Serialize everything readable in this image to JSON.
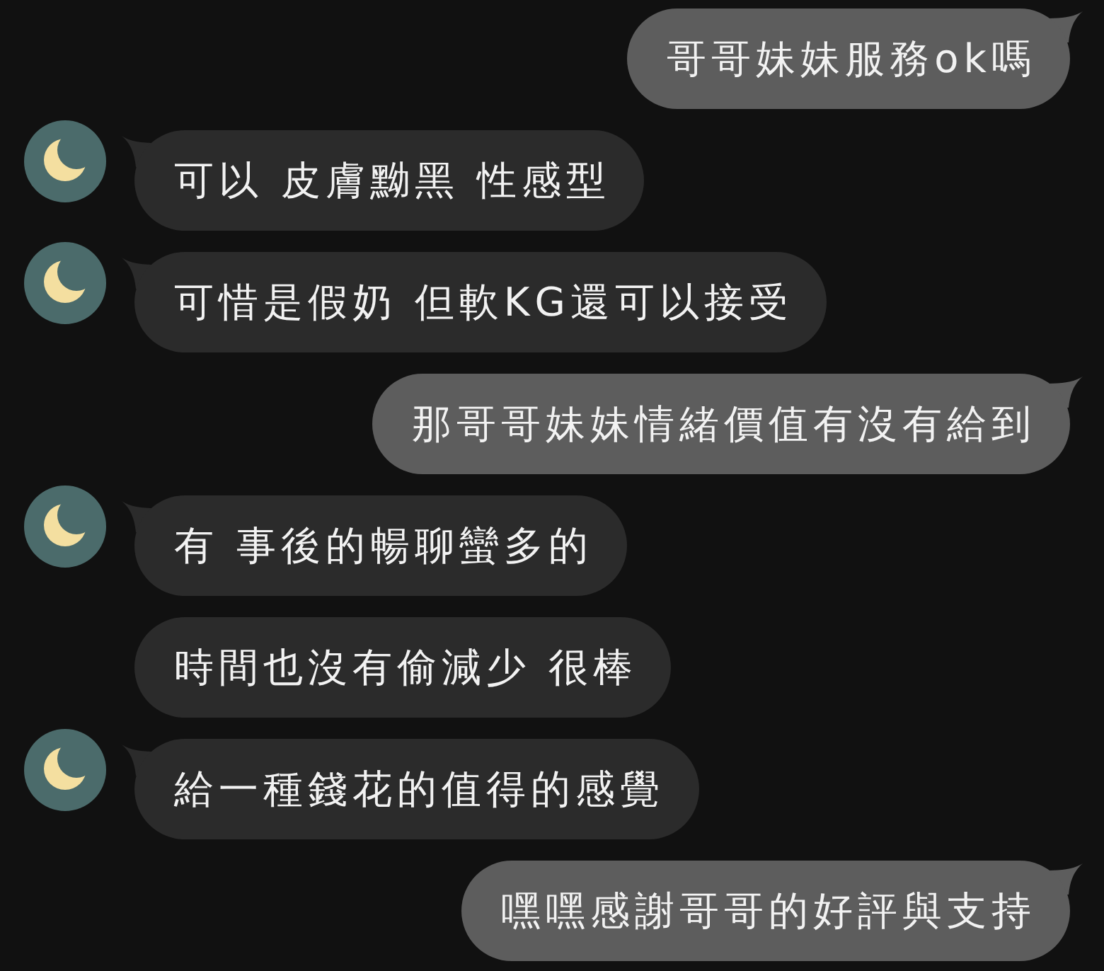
{
  "messages": [
    {
      "kind": "outgoing",
      "first_in_group": true,
      "text": "哥哥妹妹服務ok嗎"
    },
    {
      "kind": "incoming",
      "first_in_group": true,
      "text": "可以 皮膚黝黑 性感型"
    },
    {
      "kind": "incoming",
      "first_in_group": true,
      "text": "可惜是假奶 但軟KG還可以接受"
    },
    {
      "kind": "outgoing",
      "first_in_group": true,
      "text": "那哥哥妹妹情緒價值有沒有給到"
    },
    {
      "kind": "incoming",
      "first_in_group": true,
      "text": "有 事後的暢聊蠻多的"
    },
    {
      "kind": "incoming",
      "first_in_group": false,
      "text": "時間也沒有偷減少 很棒"
    },
    {
      "kind": "incoming",
      "first_in_group": true,
      "text": "給一種錢花的值得的感覺"
    },
    {
      "kind": "outgoing",
      "first_in_group": true,
      "text": "嘿嘿感謝哥哥的好評與支持"
    }
  ]
}
